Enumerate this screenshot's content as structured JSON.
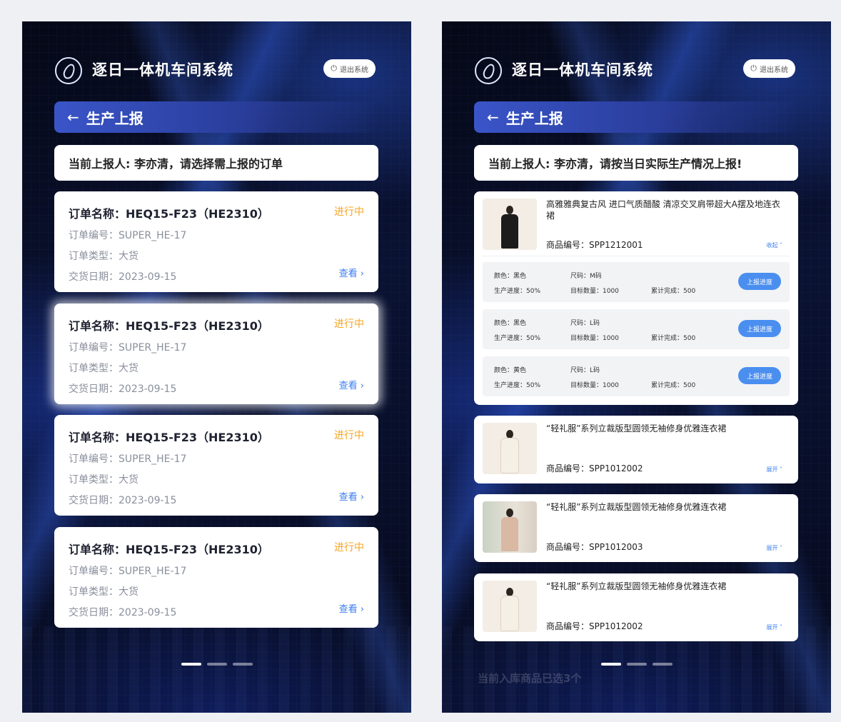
{
  "left": {
    "app_title": "逐日一体机车间系统",
    "logout_label": "退出系统",
    "page_title": "生产上报",
    "notice": "当前上报人: 李亦清，请选择需上报的订单",
    "orders": [
      {
        "name": "订单名称：HEQ15-F23（HE2310）",
        "status": "进行中",
        "number": "订单编号：SUPER_HE-17",
        "type": "订单类型：大货",
        "date": "交货日期：2023-09-15",
        "view": "查看 ›"
      },
      {
        "name": "订单名称：HEQ15-F23（HE2310）",
        "status": "进行中",
        "number": "订单编号：SUPER_HE-17",
        "type": "订单类型：大货",
        "date": "交货日期：2023-09-15",
        "view": "查看 ›"
      },
      {
        "name": "订单名称：HEQ15-F23（HE2310）",
        "status": "进行中",
        "number": "订单编号：SUPER_HE-17",
        "type": "订单类型：大货",
        "date": "交货日期：2023-09-15",
        "view": "查看 ›"
      },
      {
        "name": "订单名称：HEQ15-F23（HE2310）",
        "status": "进行中",
        "number": "订单编号：SUPER_HE-17",
        "type": "订单类型：大货",
        "date": "交货日期：2023-09-15",
        "view": "查看 ›"
      }
    ]
  },
  "right": {
    "app_title": "逐日一体机车间系统",
    "logout_label": "退出系统",
    "page_title": "生产上报",
    "notice": "当前上报人: 李亦清，请按当日实际生产情况上报!",
    "products": [
      {
        "title": "高雅雅典复古风 进口气质醋酸 清凉交叉肩带超大A摆及地连衣裙",
        "code": "商品编号：SPP1212001",
        "toggle": "收起 ˄",
        "variants": [
          {
            "color": "颜色：黑色",
            "size": "尺码：M码",
            "progress": "生产进度：50%",
            "target": "目标数量：1000",
            "done": "累计完成：500",
            "btn": "上报进度"
          },
          {
            "color": "颜色：黑色",
            "size": "尺码：L码",
            "progress": "生产进度：50%",
            "target": "目标数量：1000",
            "done": "累计完成：500",
            "btn": "上报进度"
          },
          {
            "color": "颜色：黄色",
            "size": "尺码：L码",
            "progress": "生产进度：50%",
            "target": "目标数量：1000",
            "done": "累计完成：500",
            "btn": "上报进度"
          }
        ]
      },
      {
        "title": "“轻礼服”系列立裁版型圆领无袖修身优雅连衣裙",
        "code": "商品编号：SPP1012002",
        "toggle": "展开 ˅"
      },
      {
        "title": "“轻礼服”系列立裁版型圆领无袖修身优雅连衣裙",
        "code": "商品编号：SPP1012003",
        "toggle": "展开 ˅"
      },
      {
        "title": "“轻礼服”系列立裁版型圆领无袖修身优雅连衣裙",
        "code": "商品编号：SPP1012002",
        "toggle": "展开 ˅"
      }
    ],
    "footer_note": "当前入库商品已选3个"
  },
  "icons": {
    "logo": "logo-icon",
    "power": "power-icon",
    "back": "back-arrow-icon"
  },
  "colors": {
    "status": "#f5a623",
    "link": "#3b7ded",
    "button": "#4a8ff0",
    "header_bar": "#3a55c9"
  }
}
